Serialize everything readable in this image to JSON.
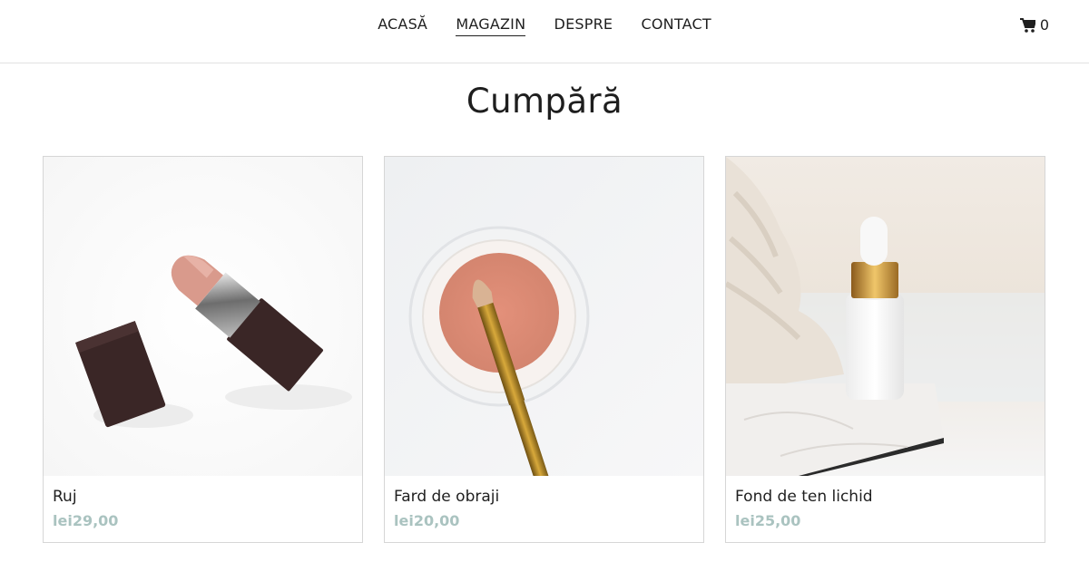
{
  "nav": {
    "items": [
      {
        "label": "ACASĂ",
        "active": false
      },
      {
        "label": "MAGAZIN",
        "active": true
      },
      {
        "label": "DESPRE",
        "active": false
      },
      {
        "label": "CONTACT",
        "active": false
      }
    ],
    "cart_count": "0",
    "cart_icon": "shopping-cart-icon"
  },
  "page": {
    "title": "Cumpără"
  },
  "products": [
    {
      "name": "Ruj",
      "price": "lei29,00",
      "image": "lipstick-image"
    },
    {
      "name": "Fard de obraji",
      "price": "lei20,00",
      "image": "blush-pot-brush-image"
    },
    {
      "name": "Fond de ten lichid",
      "price": "lei25,00",
      "image": "foundation-dropper-bottle-image"
    }
  ],
  "colors": {
    "price": "#aac3c0",
    "text": "#1f1f1f",
    "border": "#d6d6d6"
  }
}
